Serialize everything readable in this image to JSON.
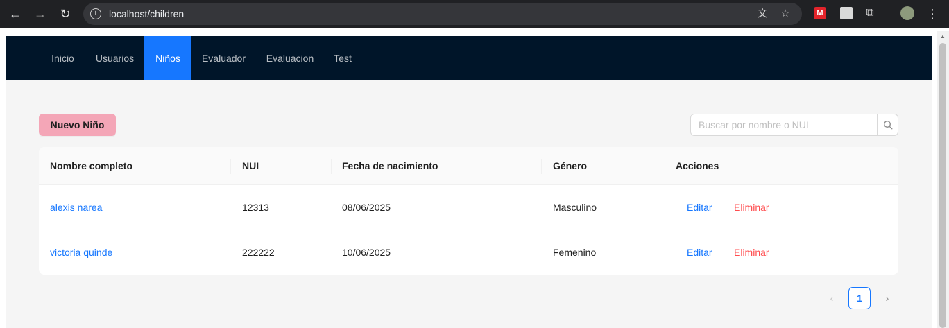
{
  "browser": {
    "url": "localhost/children",
    "back_icon": "←",
    "forward_icon": "→",
    "reload_icon": "↻",
    "info_icon": "i",
    "translate_icon": "文",
    "bookmark_icon": "☆",
    "puzzle_icon": "⧉",
    "kebab_icon": "⋮",
    "ext_red_label": "M"
  },
  "nav": {
    "items": [
      {
        "label": "Inicio"
      },
      {
        "label": "Usuarios"
      },
      {
        "label": "Niños"
      },
      {
        "label": "Evaluador"
      },
      {
        "label": "Evaluacion"
      },
      {
        "label": "Test"
      }
    ],
    "active": "Niños"
  },
  "toolbar": {
    "new_button_label": "Nuevo Niño",
    "search_placeholder": "Buscar por nombre o NUI",
    "search_value": ""
  },
  "table": {
    "columns": [
      "Nombre completo",
      "NUI",
      "Fecha de nacimiento",
      "Género",
      "Acciones"
    ],
    "rows": [
      {
        "name": "alexis narea",
        "nui": "12313",
        "birth": "08/06/2025",
        "gender": "Masculino",
        "edit": "Editar",
        "delete": "Eliminar"
      },
      {
        "name": "victoria quinde",
        "nui": "222222",
        "birth": "10/06/2025",
        "gender": "Femenino",
        "edit": "Editar",
        "delete": "Eliminar"
      }
    ]
  },
  "pagination": {
    "prev": "‹",
    "current": "1",
    "next": "›"
  },
  "colors": {
    "nav_bg": "#001529",
    "nav_active": "#1677ff",
    "new_button": "#f4a6b7",
    "link": "#1677ff",
    "danger": "#ff4d4f"
  }
}
